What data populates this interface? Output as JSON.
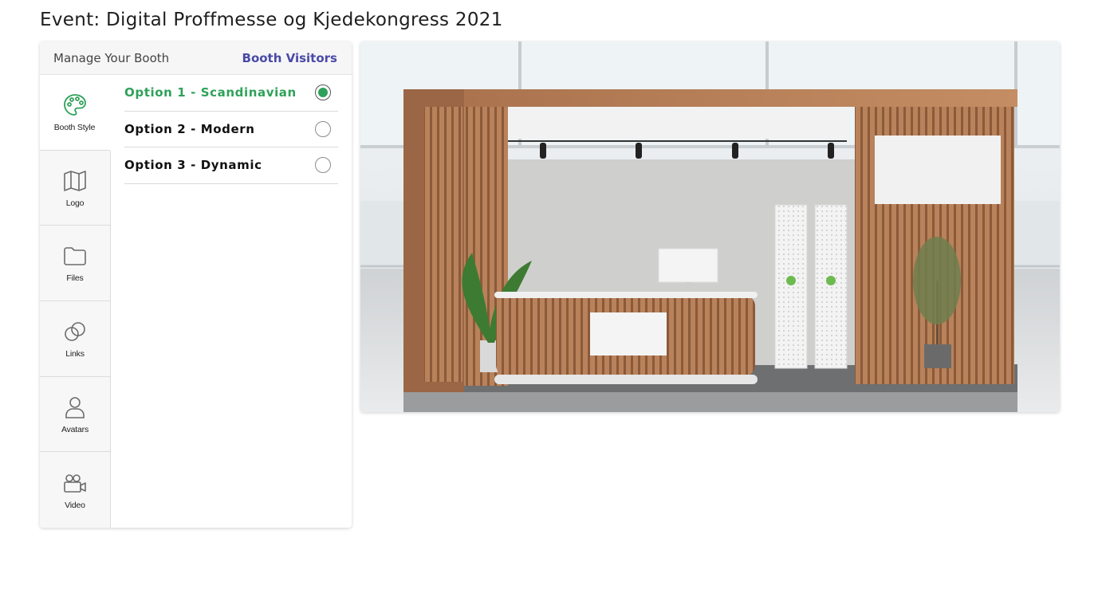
{
  "event": {
    "title": "Event: Digital Proffmesse og Kjedekongress 2021"
  },
  "panel": {
    "header": {
      "manage": "Manage Your Booth",
      "visitors": "Booth Visitors"
    },
    "sidebar": [
      {
        "label": "Booth Style",
        "icon": "palette-icon",
        "active": true
      },
      {
        "label": "Logo",
        "icon": "map-icon",
        "active": false
      },
      {
        "label": "Files",
        "icon": "folder-icon",
        "active": false
      },
      {
        "label": "Links",
        "icon": "link-icon",
        "active": false
      },
      {
        "label": "Avatars",
        "icon": "user-icon",
        "active": false
      },
      {
        "label": "Video",
        "icon": "video-camera-icon",
        "active": false
      }
    ],
    "options": [
      {
        "label": "Option 1 - Scandinavian",
        "selected": true
      },
      {
        "label": "Option 2 - Modern",
        "selected": false
      },
      {
        "label": "Option 3 - Dynamic",
        "selected": false
      }
    ]
  },
  "colors": {
    "accent_green": "#2fa15a",
    "link_purple": "#4a4aa8"
  }
}
